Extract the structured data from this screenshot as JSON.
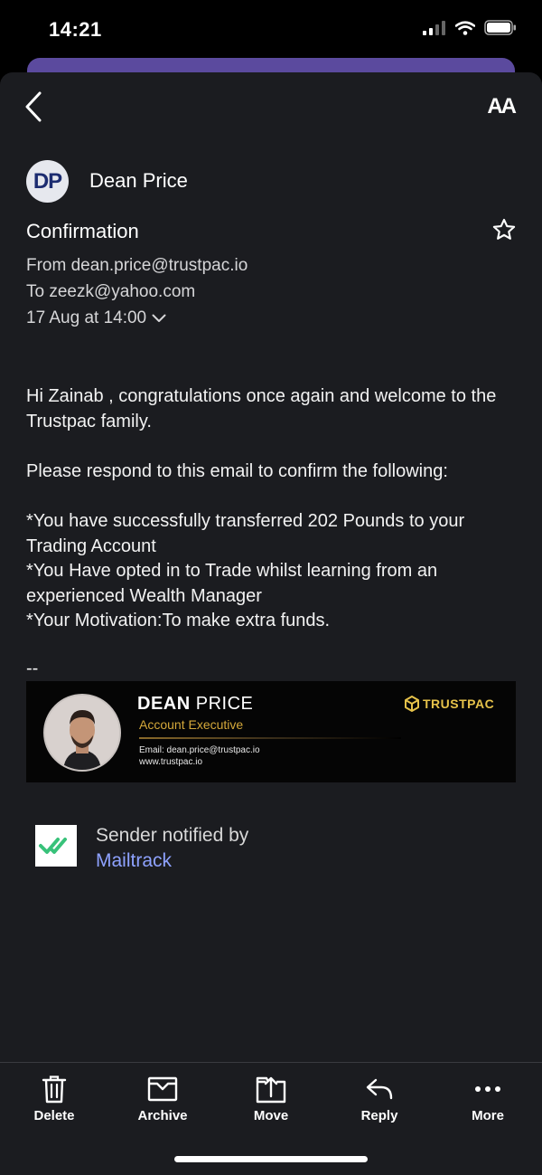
{
  "status_bar": {
    "time": "14:21"
  },
  "header": {
    "text_size_label": "AA"
  },
  "sender": {
    "initials": "DP",
    "name": "Dean Price"
  },
  "email": {
    "subject": "Confirmation",
    "from": "From dean.price@trustpac.io",
    "to": "To zeezk@yahoo.com",
    "date": "17 Aug at 14:00",
    "body": [
      "Hi Zainab , congratulations once again and welcome to the Trustpac family.",
      "Please respond to this email to confirm the following:",
      "*You have successfully transferred 202 Pounds to your Trading Account\n*You Have opted in to Trade whilst learning from an experienced Wealth Manager\n*Your Motivation:To make extra funds."
    ],
    "sig_separator": "--"
  },
  "signature": {
    "name_first": "DEAN",
    "name_last": "PRICE",
    "title": "Account Executive",
    "email": "Email: dean.price@trustpac.io",
    "website": "www.trustpac.io",
    "brand": "TRUSTPAC",
    "brand_color": "#e6c24a"
  },
  "mailtrack": {
    "text": "Sender notified by",
    "link": "Mailtrack"
  },
  "toolbar": {
    "items": [
      {
        "label": "Delete",
        "icon": "trash-icon"
      },
      {
        "label": "Archive",
        "icon": "archive-icon"
      },
      {
        "label": "Move",
        "icon": "move-icon"
      },
      {
        "label": "Reply",
        "icon": "reply-icon"
      },
      {
        "label": "More",
        "icon": "more-icon"
      }
    ]
  },
  "colors": {
    "background": "#1b1c20",
    "accent_link": "#8ea2ff",
    "purple": "#5b4a9e"
  }
}
